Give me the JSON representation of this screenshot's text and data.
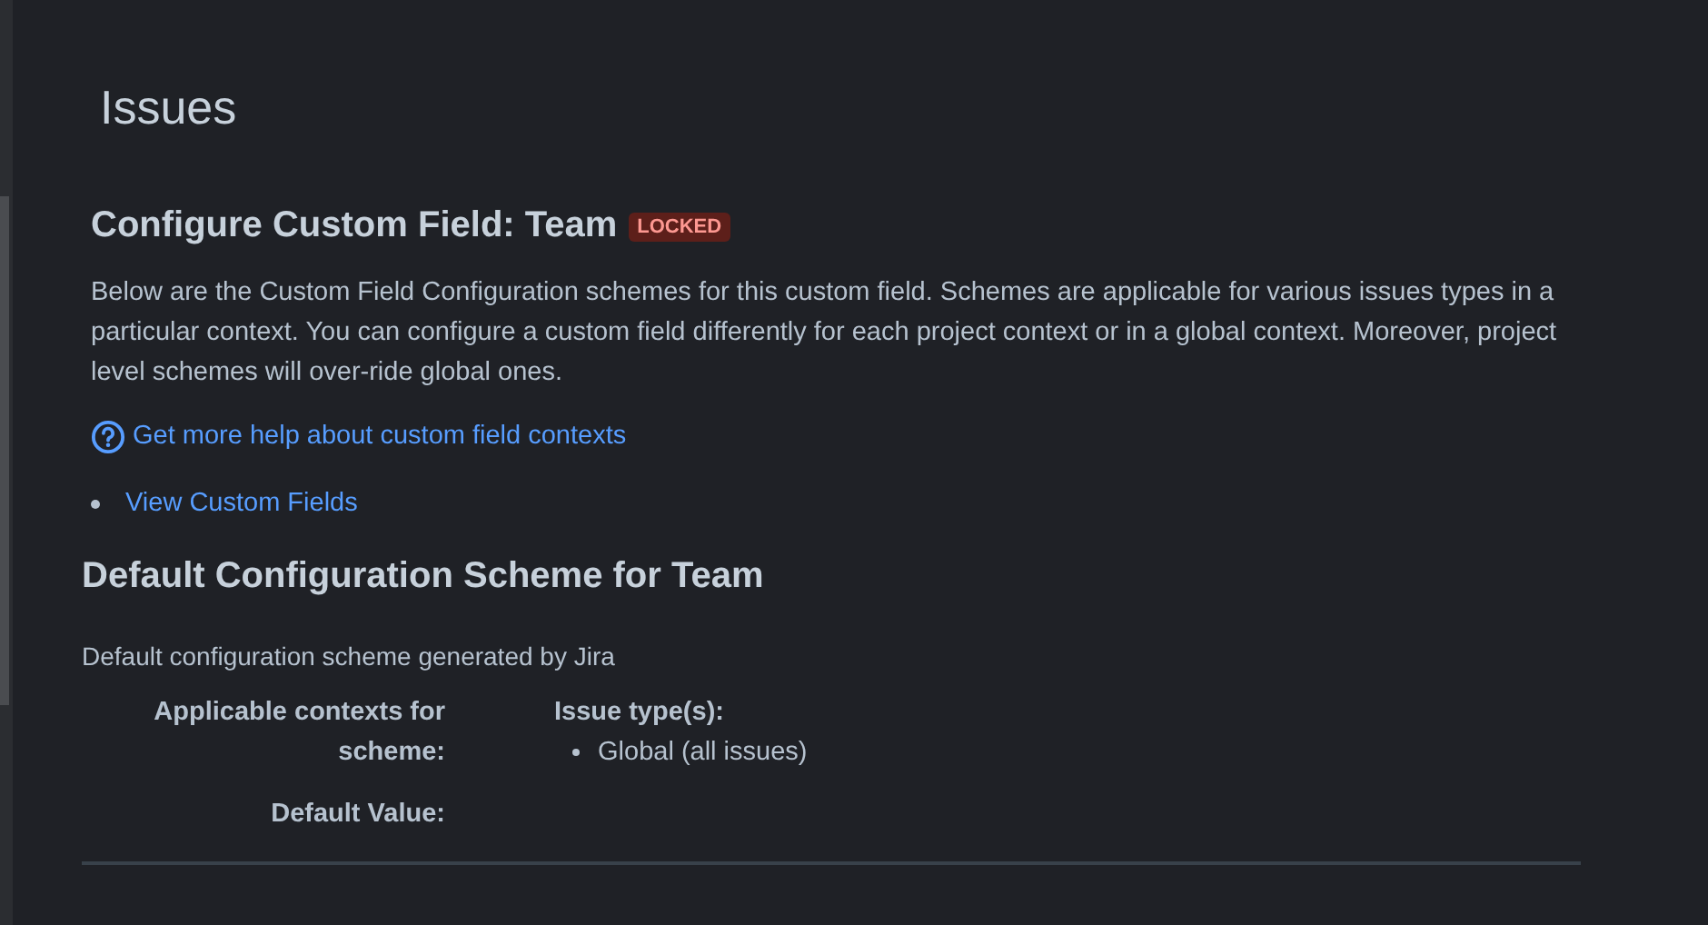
{
  "page_title": "Issues",
  "field_title": {
    "text": "Configure Custom Field: Team",
    "badge": "LOCKED"
  },
  "description": "Below are the Custom Field Configuration schemes for this custom field. Schemes are applicable for various issues types in a particular context. You can configure a custom field differently for each project context or in a global context. Moreover, project level schemes will over-ride global ones.",
  "help_link": "Get more help about custom field contexts",
  "links": [
    "View Custom Fields"
  ],
  "scheme": {
    "title": "Default Configuration Scheme for Team",
    "description": "Default configuration scheme generated by Jira",
    "rows": [
      {
        "label": "Applicable contexts for scheme:",
        "heading": "Issue type(s):",
        "items": [
          "Global (all issues)"
        ]
      },
      {
        "label": "Default Value:"
      }
    ]
  }
}
